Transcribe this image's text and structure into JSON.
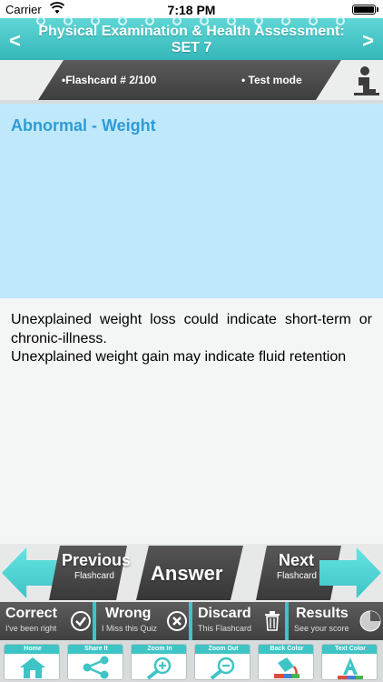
{
  "status_bar": {
    "carrier": "Carrier",
    "time": "7:18 PM"
  },
  "title_bar": {
    "title": "Physical Examination & Health Assessment: SET 7",
    "prev_glyph": "<",
    "next_glyph": ">"
  },
  "info_strip": {
    "flashcard_number": "•Flashcard #  2/100",
    "mode": "• Test mode"
  },
  "card": {
    "question": "Abnormal - Weight",
    "answer_lines": [
      "Unexplained weight loss could indicate short-term or chronic-illness.",
      "Unexplained weight gain may indicate fluid retention"
    ]
  },
  "nav": {
    "previous": {
      "label": "Previous",
      "sub": "Flashcard"
    },
    "answer": {
      "label": "Answer"
    },
    "next": {
      "label": "Next",
      "sub": "Flashcard"
    }
  },
  "actions": [
    {
      "label": "Correct",
      "sub": "I've been right",
      "icon": "check-icon"
    },
    {
      "label": "Wrong",
      "sub": "I Miss this Quiz",
      "icon": "cross-icon"
    },
    {
      "label": "Discard",
      "sub": "This Flashcard",
      "icon": "trash-icon"
    },
    {
      "label": "Results",
      "sub": "See your score",
      "icon": "pie-chart-icon"
    }
  ],
  "toolbar": [
    {
      "label": "Home",
      "icon": "home-icon"
    },
    {
      "label": "Share It",
      "icon": "share-icon"
    },
    {
      "label": "Zoom In",
      "icon": "zoom-in-icon"
    },
    {
      "label": "Zoom Out",
      "icon": "zoom-out-icon"
    },
    {
      "label": "Back Color",
      "icon": "paint-bucket-icon"
    },
    {
      "label": "Text Color",
      "icon": "text-color-icon"
    }
  ],
  "colors": {
    "accent": "#3fc4c6",
    "question_text": "#2e9bd7",
    "question_bg": "#bfe9fb",
    "dark_button": "#444444"
  }
}
